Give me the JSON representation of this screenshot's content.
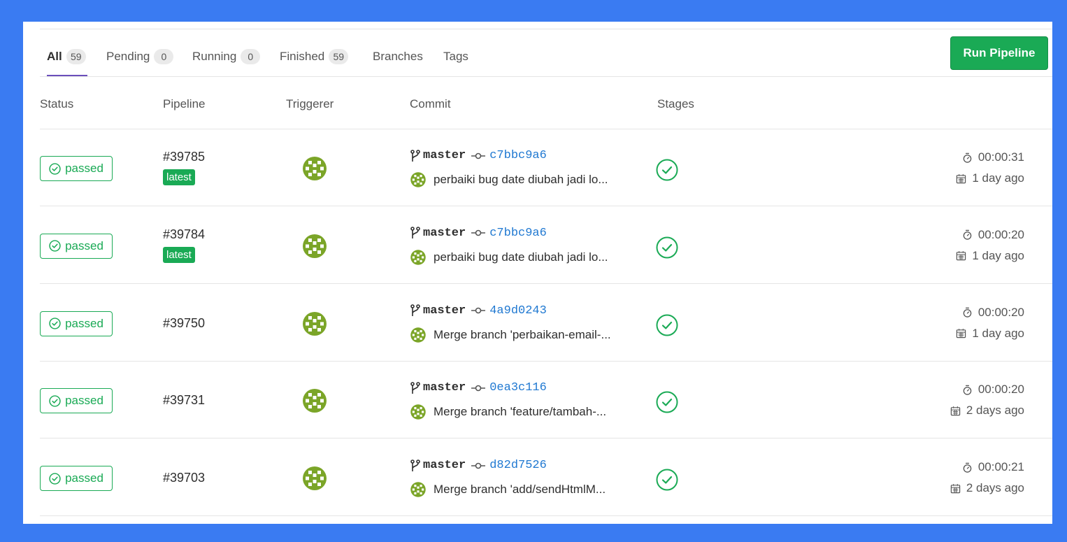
{
  "tabs": [
    {
      "label": "All",
      "count": "59",
      "active": true
    },
    {
      "label": "Pending",
      "count": "0"
    },
    {
      "label": "Running",
      "count": "0"
    },
    {
      "label": "Finished",
      "count": "59"
    },
    {
      "label": "Branches"
    },
    {
      "label": "Tags"
    }
  ],
  "run_button": "Run Pipeline",
  "headers": {
    "status": "Status",
    "pipeline": "Pipeline",
    "triggerer": "Triggerer",
    "commit": "Commit",
    "stages": "Stages"
  },
  "rows": [
    {
      "status": "passed",
      "id": "#39785",
      "tag": "latest",
      "branch": "master",
      "sha": "c7bbc9a6",
      "message": "perbaiki bug date diubah jadi lo...",
      "duration": "00:00:31",
      "finished": "1 day ago"
    },
    {
      "status": "passed",
      "id": "#39784",
      "tag": "latest",
      "branch": "master",
      "sha": "c7bbc9a6",
      "message": "perbaiki bug date diubah jadi lo...",
      "duration": "00:00:20",
      "finished": "1 day ago"
    },
    {
      "status": "passed",
      "id": "#39750",
      "tag": "",
      "branch": "master",
      "sha": "4a9d0243",
      "message": "Merge branch 'perbaikan-email-...",
      "duration": "00:00:20",
      "finished": "1 day ago"
    },
    {
      "status": "passed",
      "id": "#39731",
      "tag": "",
      "branch": "master",
      "sha": "0ea3c116",
      "message": "Merge branch 'feature/tambah-...",
      "duration": "00:00:20",
      "finished": "2 days ago"
    },
    {
      "status": "passed",
      "id": "#39703",
      "tag": "",
      "branch": "master",
      "sha": "d82d7526",
      "message": "Merge branch 'add/sendHtmlM...",
      "duration": "00:00:21",
      "finished": "2 days ago"
    }
  ],
  "colors": {
    "background": "#3a7bf2",
    "success": "#1aaa55",
    "sha_link": "#1f78d1",
    "active_tab_underline": "#6b4fbb",
    "avatar": "#7ba528"
  },
  "icons": {
    "status": "check-circle-icon",
    "branch": "branch-icon",
    "commit": "commit-icon",
    "stage": "stage-success-icon",
    "duration": "timer-icon",
    "finished": "calendar-icon",
    "avatar": "identicon-avatar"
  }
}
